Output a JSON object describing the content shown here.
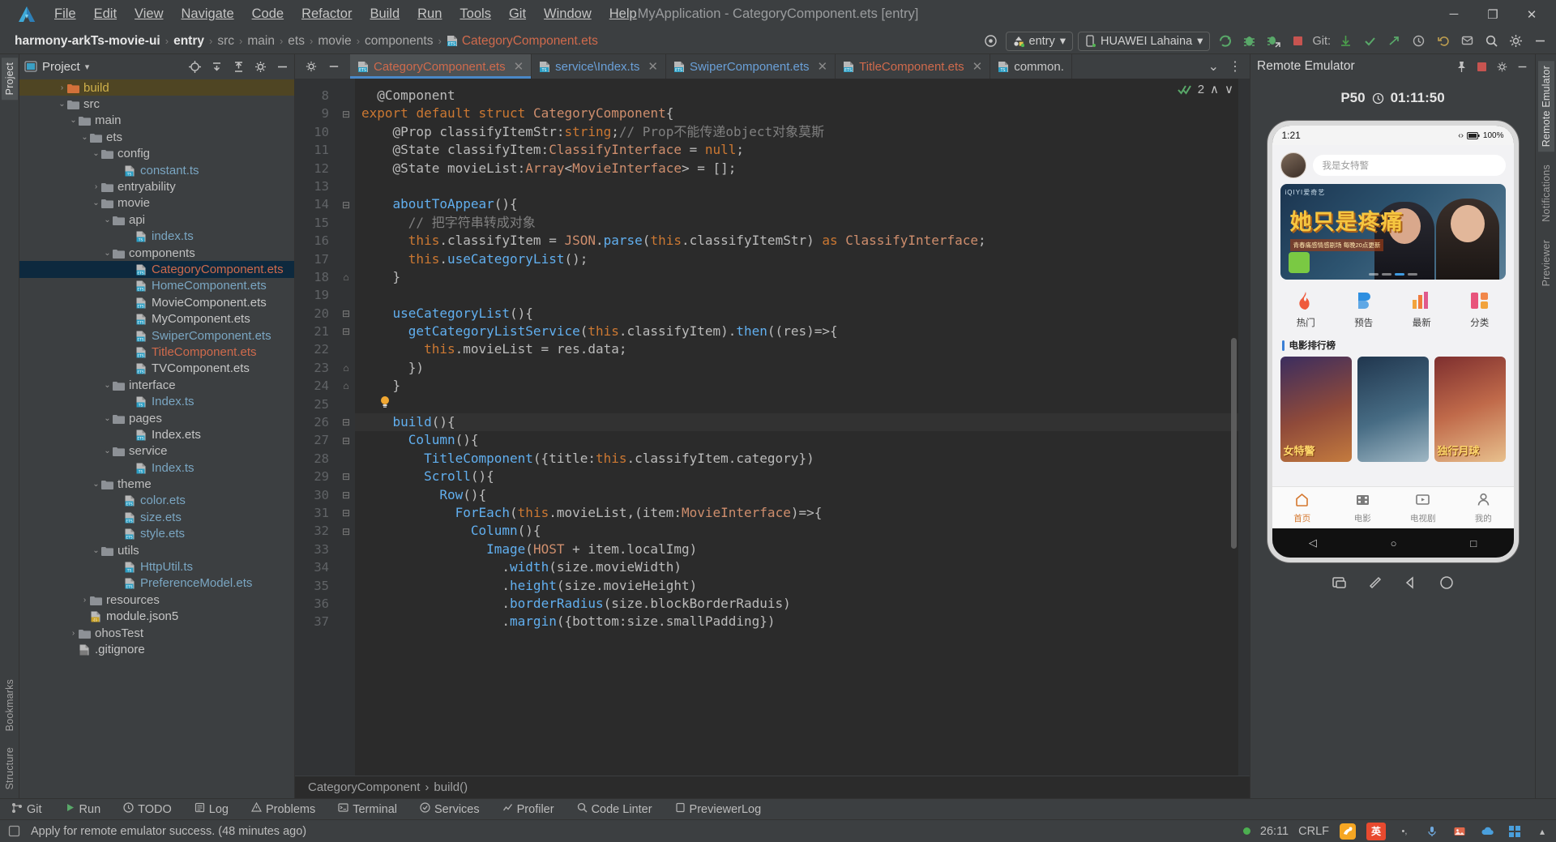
{
  "window": {
    "title": "MyApplication - CategoryComponent.ets [entry]",
    "minimize": "─",
    "maximize": "❐",
    "close": "✕"
  },
  "menubar": {
    "logo": "deveco-logo-icon",
    "items": [
      "File",
      "Edit",
      "View",
      "Navigate",
      "Code",
      "Refactor",
      "Build",
      "Run",
      "Tools",
      "Git",
      "Window",
      "Help"
    ]
  },
  "navbar": {
    "breadcrumbs": [
      {
        "label": "harmony-arkTs-movie-ui",
        "style": "bold"
      },
      {
        "label": "entry",
        "style": "bold"
      },
      {
        "label": "src",
        "style": "normal"
      },
      {
        "label": "main",
        "style": "normal"
      },
      {
        "label": "ets",
        "style": "normal"
      },
      {
        "label": "movie",
        "style": "normal"
      },
      {
        "label": "components",
        "style": "normal"
      },
      {
        "label": "CategoryComponent.ets",
        "style": "file"
      }
    ],
    "separator": "›",
    "target_selector": "entry",
    "device_selector": "HUAWEI Lahaina",
    "git_label": "Git:",
    "icons": [
      "target-icon",
      "run-icon",
      "debug-icon",
      "profile-debug-icon",
      "stop-icon",
      "update-project-icon",
      "commit-icon",
      "push-icon",
      "history-icon",
      "rollback-icon",
      "notifications-icon",
      "search-everywhere-icon",
      "settings-icon",
      "minimize-icon"
    ]
  },
  "left_rail": {
    "top": "Project",
    "bottom": [
      "Bookmarks",
      "Structure"
    ]
  },
  "project_panel": {
    "title": "Project",
    "chevron": "▾",
    "actions": [
      "locate-icon",
      "collapse-all-icon",
      "expand-all-icon",
      "settings-icon",
      "hide-icon"
    ],
    "tree": [
      {
        "label": "build",
        "indent": 3,
        "type": "folder-orange",
        "arrow": "›",
        "state": "highlight"
      },
      {
        "label": "src",
        "indent": 3,
        "type": "folder",
        "arrow": "⌄"
      },
      {
        "label": "main",
        "indent": 4,
        "type": "folder",
        "arrow": "⌄"
      },
      {
        "label": "ets",
        "indent": 5,
        "type": "folder",
        "arrow": "⌄"
      },
      {
        "label": "config",
        "indent": 6,
        "type": "folder",
        "arrow": "⌄"
      },
      {
        "label": "constant.ts",
        "indent": 8,
        "type": "ts",
        "arrow": ""
      },
      {
        "label": "entryability",
        "indent": 6,
        "type": "folder",
        "arrow": "›"
      },
      {
        "label": "movie",
        "indent": 6,
        "type": "folder",
        "arrow": "⌄"
      },
      {
        "label": "api",
        "indent": 7,
        "type": "folder",
        "arrow": "⌄"
      },
      {
        "label": "index.ts",
        "indent": 9,
        "type": "ts",
        "arrow": ""
      },
      {
        "label": "components",
        "indent": 7,
        "type": "folder",
        "arrow": "⌄"
      },
      {
        "label": "CategoryComponent.ets",
        "indent": 9,
        "type": "ets-red",
        "arrow": "",
        "state": "selected"
      },
      {
        "label": "HomeComponent.ets",
        "indent": 9,
        "type": "ets",
        "arrow": ""
      },
      {
        "label": "MovieComponent.ets",
        "indent": 9,
        "type": "ets-plain",
        "arrow": ""
      },
      {
        "label": "MyComponent.ets",
        "indent": 9,
        "type": "ets-plain",
        "arrow": ""
      },
      {
        "label": "SwiperComponent.ets",
        "indent": 9,
        "type": "ets",
        "arrow": ""
      },
      {
        "label": "TitleComponent.ets",
        "indent": 9,
        "type": "ets-red",
        "arrow": ""
      },
      {
        "label": "TVComponent.ets",
        "indent": 9,
        "type": "ets-plain",
        "arrow": ""
      },
      {
        "label": "interface",
        "indent": 7,
        "type": "folder",
        "arrow": "⌄"
      },
      {
        "label": "Index.ts",
        "indent": 9,
        "type": "ts",
        "arrow": ""
      },
      {
        "label": "pages",
        "indent": 7,
        "type": "folder",
        "arrow": "⌄"
      },
      {
        "label": "Index.ets",
        "indent": 9,
        "type": "ets-plain",
        "arrow": ""
      },
      {
        "label": "service",
        "indent": 7,
        "type": "folder",
        "arrow": "⌄"
      },
      {
        "label": "Index.ts",
        "indent": 9,
        "type": "ts",
        "arrow": ""
      },
      {
        "label": "theme",
        "indent": 6,
        "type": "folder",
        "arrow": "⌄"
      },
      {
        "label": "color.ets",
        "indent": 8,
        "type": "ets",
        "arrow": ""
      },
      {
        "label": "size.ets",
        "indent": 8,
        "type": "ets",
        "arrow": ""
      },
      {
        "label": "style.ets",
        "indent": 8,
        "type": "ets",
        "arrow": ""
      },
      {
        "label": "utils",
        "indent": 6,
        "type": "folder",
        "arrow": "⌄"
      },
      {
        "label": "HttpUtil.ts",
        "indent": 8,
        "type": "ts",
        "arrow": ""
      },
      {
        "label": "PreferenceModel.ets",
        "indent": 8,
        "type": "ets",
        "arrow": ""
      },
      {
        "label": "resources",
        "indent": 5,
        "type": "folder",
        "arrow": "›"
      },
      {
        "label": "module.json5",
        "indent": 5,
        "type": "json",
        "arrow": ""
      },
      {
        "label": "ohosTest",
        "indent": 4,
        "type": "folder",
        "arrow": "›"
      },
      {
        "label": ".gitignore",
        "indent": 4,
        "type": "file",
        "arrow": ""
      }
    ]
  },
  "editor": {
    "tabs": [
      {
        "label": "CategoryComponent.ets",
        "icon": "ets-file-icon",
        "color": "red",
        "active": true,
        "close": "✕"
      },
      {
        "label": "service\\Index.ts",
        "icon": "ts-file-icon",
        "color": "blue",
        "active": false,
        "close": "✕"
      },
      {
        "label": "SwiperComponent.ets",
        "icon": "ets-file-icon",
        "color": "blue",
        "active": false,
        "close": "✕"
      },
      {
        "label": "TitleComponent.ets",
        "icon": "ets-file-icon",
        "color": "red",
        "active": false,
        "close": "✕"
      },
      {
        "label": "common.",
        "icon": "ts-file-icon",
        "color": "plain",
        "active": false,
        "close": ""
      }
    ],
    "tab_overflow": "⌄",
    "tab_menu": "⋮",
    "inspection_count": "2",
    "inspection_up": "∧",
    "inspection_down": "∨",
    "first_line_number": 8,
    "current_line": 26,
    "lines": [
      {
        "n": 8,
        "fold": "",
        "text": "  @Component"
      },
      {
        "n": 9,
        "fold": "⊟",
        "text": "export default struct CategoryComponent{"
      },
      {
        "n": 10,
        "fold": "",
        "text": "    @Prop classifyItemStr:string;// Prop不能传递object对象莫斯"
      },
      {
        "n": 11,
        "fold": "",
        "text": "    @State classifyItem:ClassifyInterface = null;"
      },
      {
        "n": 12,
        "fold": "",
        "text": "    @State movieList:Array<MovieInterface> = [];"
      },
      {
        "n": 13,
        "fold": "",
        "text": ""
      },
      {
        "n": 14,
        "fold": "⊟",
        "text": "    aboutToAppear(){"
      },
      {
        "n": 15,
        "fold": "",
        "text": "      // 把字符串转成对象"
      },
      {
        "n": 16,
        "fold": "",
        "text": "      this.classifyItem = JSON.parse(this.classifyItemStr) as ClassifyInterface;"
      },
      {
        "n": 17,
        "fold": "",
        "text": "      this.useCategoryList();"
      },
      {
        "n": 18,
        "fold": "⌂",
        "text": "    }"
      },
      {
        "n": 19,
        "fold": "",
        "text": ""
      },
      {
        "n": 20,
        "fold": "⊟",
        "text": "    useCategoryList(){"
      },
      {
        "n": 21,
        "fold": "⊟",
        "text": "      getCategoryListService(this.classifyItem).then((res)=>{"
      },
      {
        "n": 22,
        "fold": "",
        "text": "        this.movieList = res.data;"
      },
      {
        "n": 23,
        "fold": "⌂",
        "text": "      })"
      },
      {
        "n": 24,
        "fold": "⌂",
        "text": "    }"
      },
      {
        "n": 25,
        "fold": "",
        "text": ""
      },
      {
        "n": 26,
        "fold": "⊟",
        "text": "    build(){"
      },
      {
        "n": 27,
        "fold": "⊟",
        "text": "      Column(){"
      },
      {
        "n": 28,
        "fold": "",
        "text": "        TitleComponent({title:this.classifyItem.category})"
      },
      {
        "n": 29,
        "fold": "⊟",
        "text": "        Scroll(){"
      },
      {
        "n": 30,
        "fold": "⊟",
        "text": "          Row(){"
      },
      {
        "n": 31,
        "fold": "⊟",
        "text": "            ForEach(this.movieList,(item:MovieInterface)=>{"
      },
      {
        "n": 32,
        "fold": "⊟",
        "text": "              Column(){"
      },
      {
        "n": 33,
        "fold": "",
        "text": "                Image(HOST + item.localImg)"
      },
      {
        "n": 34,
        "fold": "",
        "text": "                  .width(size.movieWidth)"
      },
      {
        "n": 35,
        "fold": "",
        "text": "                  .height(size.movieHeight)"
      },
      {
        "n": 36,
        "fold": "",
        "text": "                  .borderRadius(size.blockBorderRaduis)"
      },
      {
        "n": 37,
        "fold": "",
        "text": "                  .margin({bottom:size.smallPadding})"
      }
    ],
    "bulb_line": 25,
    "bulb": "💡",
    "footer_breadcrumb": [
      "CategoryComponent",
      "build()"
    ],
    "footer_separator": "›"
  },
  "emulator": {
    "panel_title": "Remote Emulator",
    "panel_actions": [
      "pin-icon",
      "stop-icon",
      "settings-icon",
      "minimize-icon"
    ],
    "device_name": "P50",
    "timer_icon": "clock-icon",
    "timer": "01:11:50",
    "phone": {
      "status_time": "1:21",
      "status_icons": "‹›",
      "battery": "100%",
      "search_placeholder": "我是女特警",
      "banner": {
        "brand": "iQIYI爱奇艺",
        "title": "她只是疼痛",
        "subtitle": "青春痛感情感剧场 每晚20点更新"
      },
      "categories": [
        {
          "label": "热门",
          "icon": "flame-icon"
        },
        {
          "label": "预告",
          "icon": "play-badge-icon"
        },
        {
          "label": "最新",
          "icon": "bars-icon"
        },
        {
          "label": "分类",
          "icon": "grid-icon"
        }
      ],
      "rank_title": "电影排行榜",
      "posters": [
        {
          "title": "女特警"
        },
        {
          "title": ""
        },
        {
          "title": "独行月球"
        }
      ],
      "nav": [
        {
          "label": "首页",
          "icon": "home-icon",
          "active": true
        },
        {
          "label": "电影",
          "icon": "film-icon",
          "active": false
        },
        {
          "label": "电视剧",
          "icon": "tv-icon",
          "active": false
        },
        {
          "label": "我的",
          "icon": "person-icon",
          "active": false
        }
      ],
      "sys_nav": [
        "◁",
        "○",
        "□"
      ]
    },
    "tool_icons": [
      "screenshot-icon",
      "rotate-icon",
      "back-icon",
      "home-circle-icon"
    ]
  },
  "right_rail": [
    "remote-emulator-vtab",
    "notifications-vtab",
    "previewer-vtab"
  ],
  "toolwindow_bar": [
    {
      "label": "Git",
      "icon": "git-icon"
    },
    {
      "label": "Run",
      "icon": "run-icon"
    },
    {
      "label": "TODO",
      "icon": "todo-icon"
    },
    {
      "label": "Log",
      "icon": "log-icon"
    },
    {
      "label": "Problems",
      "icon": "problems-icon"
    },
    {
      "label": "Terminal",
      "icon": "terminal-icon"
    },
    {
      "label": "Services",
      "icon": "services-icon"
    },
    {
      "label": "Profiler",
      "icon": "profiler-icon"
    },
    {
      "label": "Code Linter",
      "icon": "linter-icon"
    },
    {
      "label": "PreviewerLog",
      "icon": "previewer-icon"
    }
  ],
  "statusbar": {
    "message": "Apply for remote emulator success. (48 minutes ago)",
    "caret": "26:11",
    "line_sep": "CRLF",
    "ime_label": "英",
    "tray_icons": [
      "ime-icon",
      "mic-icon",
      "gallery-icon",
      "cloud-icon",
      "apps-icon",
      "chevron-icon"
    ]
  }
}
